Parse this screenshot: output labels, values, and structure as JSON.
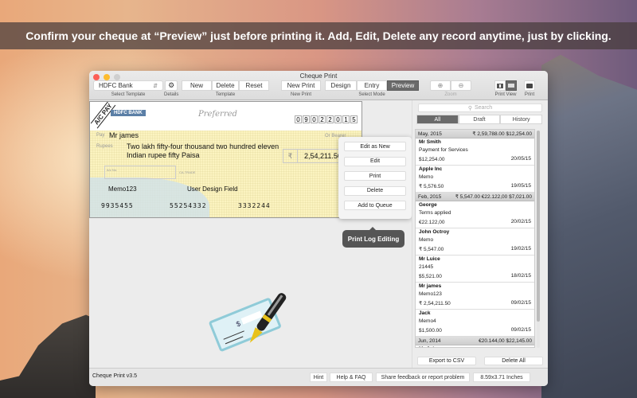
{
  "banner": "Confirm your cheque at “Preview” just before printing it. Add, Edit, Delete any record anytime, just by clicking.",
  "window": {
    "title": "Cheque Print"
  },
  "toolbar": {
    "template_select": "HDFC Bank",
    "select_template_label": "Select Template",
    "details_label": "Details",
    "template_buttons": [
      "New",
      "Delete",
      "Reset"
    ],
    "template_label": "Template",
    "new_print": "New Print",
    "new_print_label": "New Print",
    "modes": [
      "Design",
      "Entry",
      "Preview"
    ],
    "active_mode": "Preview",
    "select_mode_label": "Select Mode",
    "zoom_in_icon": "zoom-in-icon",
    "zoom_out_icon": "zoom-out-icon",
    "zoom_label": "Zoom",
    "print_view_label": "Print View",
    "print_label": "Print"
  },
  "cheque": {
    "crossing": "A/C PAY",
    "bank_name": "HDFC BANK",
    "brand": "Preferred",
    "date_digits": [
      "0",
      "9",
      "0",
      "2",
      "2",
      "0",
      "1",
      "5"
    ],
    "pay_label": "Pay",
    "payee": "Mr james",
    "bearer": "Or Bearer",
    "rupees_label": "Rupees",
    "amount_words": "Two lakh fifty-four thousand two hundred eleven Indian rupee fifty Paisa",
    "currency_symbol": "₹",
    "amount": "2,54,211.50",
    "acno_label": "A/c No.",
    "account_type": "CA-TRADE",
    "memo": "Memo123",
    "user_field": "User Design Field",
    "micr": [
      "9935455",
      "55254332",
      "3332244"
    ]
  },
  "popover": {
    "buttons": [
      "Edit as New",
      "Edit",
      "Print",
      "Delete",
      "Add to Queue"
    ],
    "tooltip": "Print Log Editing"
  },
  "sidebar": {
    "search_placeholder": "Search",
    "tabs": [
      "All",
      "Draft",
      "History"
    ],
    "active_tab": "All",
    "groups": [
      {
        "month": "May, 2015",
        "totals": "₹ 2,59,788.00 $12,254.00",
        "items": [
          {
            "name": "Mr Smith",
            "memo": "Payment for Services",
            "amount": "$12,254.00",
            "date": "20/05/15"
          },
          {
            "name": "Apple Inc",
            "memo": "Memo",
            "amount": "₹ 5,576.50",
            "date": "19/05/15"
          }
        ]
      },
      {
        "month": "Feb, 2015",
        "totals": "₹ 5,547.00 €22.122,00 $7,021.00",
        "items": [
          {
            "name": "George",
            "memo": "Terms applied",
            "amount": "€22.122,00",
            "date": "20/02/15"
          },
          {
            "name": "John Octroy",
            "memo": "Memo",
            "amount": "₹ 5,547.00",
            "date": "19/02/15"
          },
          {
            "name": "Mr Luice",
            "memo": "21445",
            "amount": "$5,521.00",
            "date": "18/02/15"
          },
          {
            "name": "Mr james",
            "memo": "Memo123",
            "amount": "₹ 2,54,211.50",
            "date": "09/02/15"
          },
          {
            "name": "Jack",
            "memo": "Memo4",
            "amount": "$1,500.00",
            "date": "09/02/15"
          }
        ]
      },
      {
        "month": "Jun, 2014",
        "totals": "€20.144,00 $22,145.00",
        "items": [
          {
            "name": "Mr John",
            "memo": "",
            "amount": "",
            "date": ""
          }
        ]
      }
    ],
    "export_button": "Export to CSV",
    "delete_all_button": "Delete All"
  },
  "statusbar": {
    "version": "Cheque Print v3.5",
    "hint": "Hint",
    "help": "Help & FAQ",
    "feedback": "Share feedback or report problem",
    "size": "8.59x3.71 Inches"
  }
}
